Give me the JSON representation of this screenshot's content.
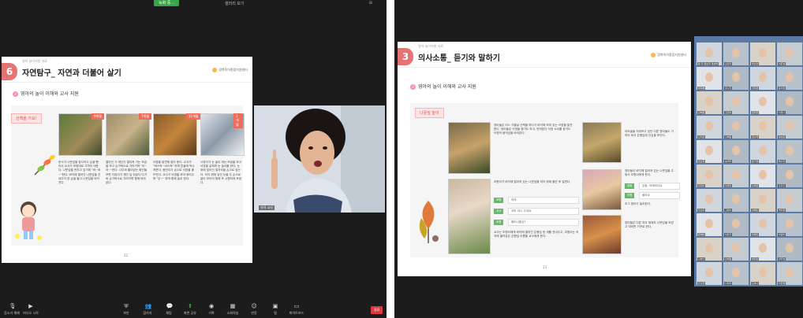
{
  "left": {
    "recording_banner": "녹화 중…",
    "view_label": "갤러리 보기",
    "slide": {
      "number": "6",
      "top_label": "영아 놀이지원 자료",
      "title": "자연탐구_ 자연과 더불어 살기",
      "logo": "경북육아종합지원센터",
      "subtitle_num": "2",
      "subtitle": "영아의 놀이 이해와 교사 지원",
      "tab": "산책을 가요!",
      "age_badges": [
        "9개월",
        "7개월",
        "11개월",
        "1개월"
      ],
      "columns": [
        "준서가 나뭇잎을 잡으려고 손을 뻗어서 교사가 모양대로 가까이 대준다. 나뭇잎을 만지고 있기에 \"와~와~\"한다. 바닥에 떨어진 나뭇잎을 건네주자 양 손을 들고 나뭇잎을 바닥친다.",
        "떨어진 가 계단가 떨어져 가는 모습을 보고 손가락으로 가리키며 \"아~아~\"한다. 나무와 풀이었는 화단을 보면 지엄이가 개인 잎 쥐었다 다가와 손가락으로 가리키며 함께 바라본다.",
        "낙엽을 발견해 잡아 준다. 교사가 \"바스락~바스락\" 하며 흔들며 박수 쳐준다. 종민이가 손으로 낙엽을 흩뜨린다. 교사가 낙엽을 모아 뿌려주며 \"우~\" 하며 함께 놀이 한다.",
        "시영이가 눈 놀이 하는 모습을 보고 낙엽을 살피며 눈 놀이를 한다. 눈 위에 엎어진 발자국을 손으로 잡는다. 의자 위에 놓인 눈을 두 손으로 쓸어 모아서 함께 또 시원하게 보낸다."
      ],
      "page": "22"
    },
    "video_name": "유아 교사",
    "toolbar": [
      {
        "icon": "mic-icon",
        "label": "음소거 해제"
      },
      {
        "icon": "video-icon",
        "label": "비디오 시작"
      },
      {
        "icon": "shield-icon",
        "label": "보안"
      },
      {
        "icon": "participants-icon",
        "label": "참가자"
      },
      {
        "icon": "chat-icon",
        "label": "채팅"
      },
      {
        "icon": "share-icon",
        "label": "화면 공유"
      },
      {
        "icon": "record-icon",
        "label": "기록"
      },
      {
        "icon": "cc-icon",
        "label": "소회의실"
      },
      {
        "icon": "reaction-icon",
        "label": "반응"
      },
      {
        "icon": "apps-icon",
        "label": "앱"
      },
      {
        "icon": "whiteboard-icon",
        "label": "화이트보드"
      }
    ],
    "end_label": "종료"
  },
  "right": {
    "slide": {
      "number": "3",
      "top_label": "영아 놀이지원 자료",
      "title": "의사소통_ 듣기와 말하기",
      "logo": "경북육아종합지원센터",
      "subtitle_num": "2",
      "subtitle": "영아의 놀이 이해와 교사 지원",
      "tab": "나뭇잎 놀이",
      "text_top": "영아들은 어느 가을날 산책을 하다가 바닥에 모여 있는 낙엽을 발견한다. 영아들은 낙엽을 줍기도 하고, 만져본다 낙엽 소리를 듣기도 낙엽의 움직임을 바라본다.",
      "text_mid": "조원이가 바닥에 떨어져 있는 나뭇잎을 의자 위에 올린 후 말한다.",
      "tags": [
        "조원",
        "교사",
        "조원"
      ],
      "quotes": [
        "꺄까.",
        "꼬마 아니 주세요",
        "할머니할깅?"
      ],
      "text_bottom": "교사는 조원이에게 바닥에 떨어진 은행잎 한 개를 건네주고, 조원이는 의자에 올려놓은 은행잎 이름을 교사에게 준다.",
      "right_text_1": "아모솔을 지켜보고 있던 다른 영아들도 가까이 와서 은행잎에 관심을 보인다.",
      "right_text_2": "영아들이 바닥에 떨어져 있는 나뭇잎을 주워서 조원이에게 준다.",
      "right_tags": [
        "영희",
        "조원"
      ],
      "right_quotes": [
        "있음, 억래바다요",
        "몰라요"
      ],
      "right_text_3": "조그 영아가 놀이한다.",
      "right_text_4": "영아들은 다른 의자 위에도 나뭇잎을 모았고 여러번 거꾸로 한다.",
      "page": "23"
    },
    "gallery_names": [
      "풍 주 열보우 경상박",
      "김민지",
      "박소연",
      "이은정",
      "최지혜",
      "정수진",
      "한미경",
      "윤서영",
      "강혜원",
      "조은비",
      "임지현",
      "서유나",
      "오지은",
      "신혜림",
      "권나래",
      "황보람",
      "안소희",
      "송미라",
      "문가영",
      "배수지",
      "유진아",
      "남궁민",
      "노하은",
      "홍다인",
      "전소미",
      "고은아",
      "장예린",
      "백지영",
      "류세아",
      "차은주",
      "주혜진",
      "하윤미",
      "구슬기",
      "민채원",
      "석다은",
      "양희정",
      "진소연",
      "나유리",
      "도하나",
      "마은별"
    ]
  }
}
